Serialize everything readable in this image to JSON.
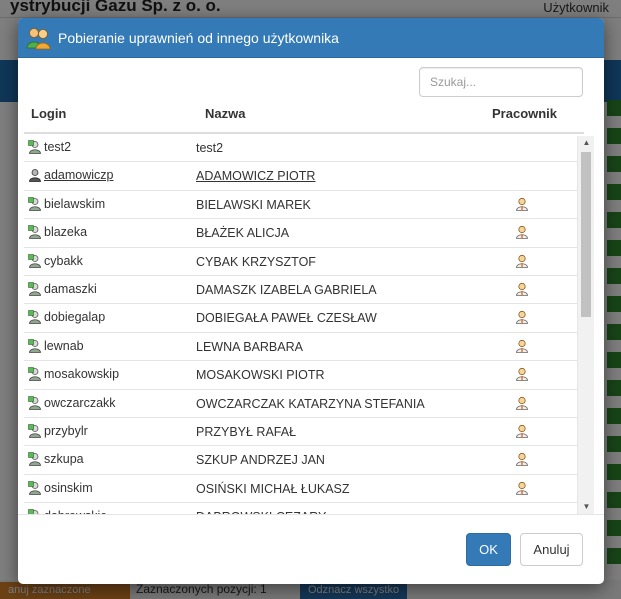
{
  "background": {
    "title": "ystrybucji Gazu Sp. z o. o.",
    "user_label": "Użytkownik",
    "bottom_orange_label": "anuj zaznaczone",
    "bottom_selected_text": "Zaznaczonych pozycji: 1",
    "bottom_button_label": "Odznacz wszystko"
  },
  "modal": {
    "title": "Pobieranie uprawnień od innego użytkownika",
    "search_placeholder": "Szukaj...",
    "columns": {
      "login": "Login",
      "nazwa": "Nazwa",
      "pracownik": "Pracownik"
    },
    "rows": [
      {
        "login": "test2",
        "nazwa": "test2",
        "pracownik": false,
        "active": false
      },
      {
        "login": "adamowiczp",
        "nazwa": "ADAMOWICZ PIOTR",
        "pracownik": false,
        "active": true
      },
      {
        "login": "bielawskim",
        "nazwa": "BIELAWSKI MAREK",
        "pracownik": true,
        "active": false
      },
      {
        "login": "blazeka",
        "nazwa": "BŁAŻEK ALICJA",
        "pracownik": true,
        "active": false
      },
      {
        "login": "cybakk",
        "nazwa": "CYBAK KRZYSZTOF",
        "pracownik": true,
        "active": false
      },
      {
        "login": "damaszki",
        "nazwa": "DAMASZK IZABELA GABRIELA",
        "pracownik": true,
        "active": false
      },
      {
        "login": "dobiegalap",
        "nazwa": "DOBIEGAŁA PAWEŁ CZESŁAW",
        "pracownik": true,
        "active": false
      },
      {
        "login": "lewnab",
        "nazwa": "LEWNA BARBARA",
        "pracownik": true,
        "active": false
      },
      {
        "login": "mosakowskip",
        "nazwa": "MOSAKOWSKI PIOTR",
        "pracownik": true,
        "active": false
      },
      {
        "login": "owczarczakk",
        "nazwa": "OWCZARCZAK KATARZYNA STEFANIA",
        "pracownik": true,
        "active": false
      },
      {
        "login": "przybylr",
        "nazwa": "PRZYBYŁ RAFAŁ",
        "pracownik": true,
        "active": false
      },
      {
        "login": "szkupa",
        "nazwa": "SZKUP ANDRZEJ JAN",
        "pracownik": true,
        "active": false
      },
      {
        "login": "osinskim",
        "nazwa": "OSIŃSKI MICHAŁ ŁUKASZ",
        "pracownik": true,
        "active": false
      },
      {
        "login": "dabrowskic",
        "nazwa": "DĄBROWSKI CEZARY",
        "pracownik": false,
        "active": false
      }
    ],
    "ok_label": "OK",
    "cancel_label": "Anuluj"
  },
  "icons": {
    "header": "users-icon",
    "row_login": "user-icon",
    "pracownik": "employee-icon"
  },
  "colors": {
    "header_bg": "#337ab7",
    "ok_bg": "#337ab7",
    "user_icon_green": "#4a9a2a"
  }
}
